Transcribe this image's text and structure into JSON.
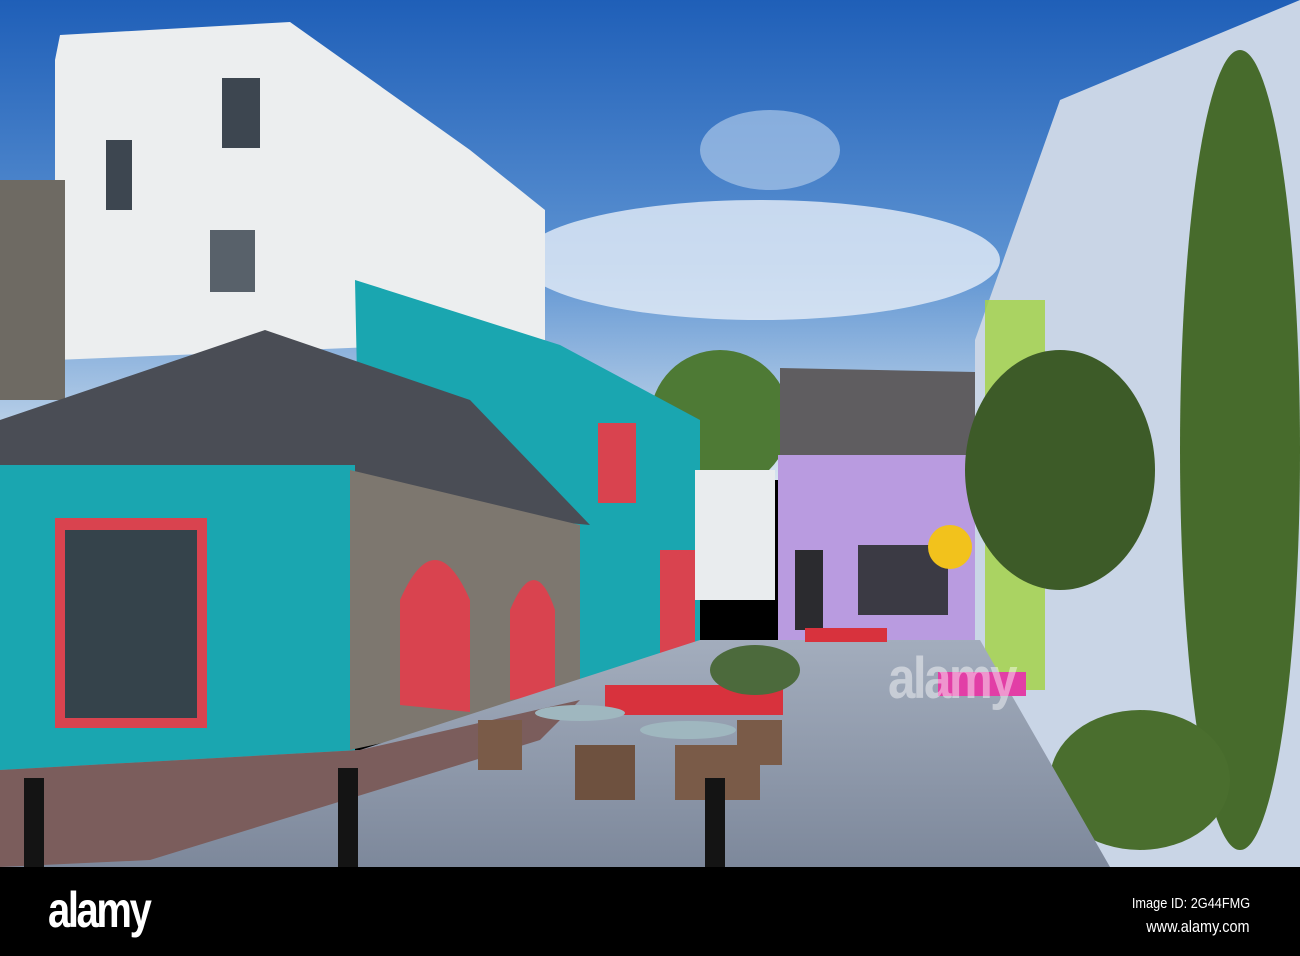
{
  "watermark": {
    "logo": "alamy",
    "overlay": "alamy"
  },
  "footer": {
    "image_id": "Image ID: 2G44FMG",
    "website": "www.alamy.com"
  },
  "colors": {
    "sky_top": "#1f5fb8",
    "sky_bottom": "#c9dcef",
    "teal": "#1aa6b0",
    "purple": "#b99be0",
    "red": "#d9434f",
    "pavement": "#8f9aad"
  }
}
